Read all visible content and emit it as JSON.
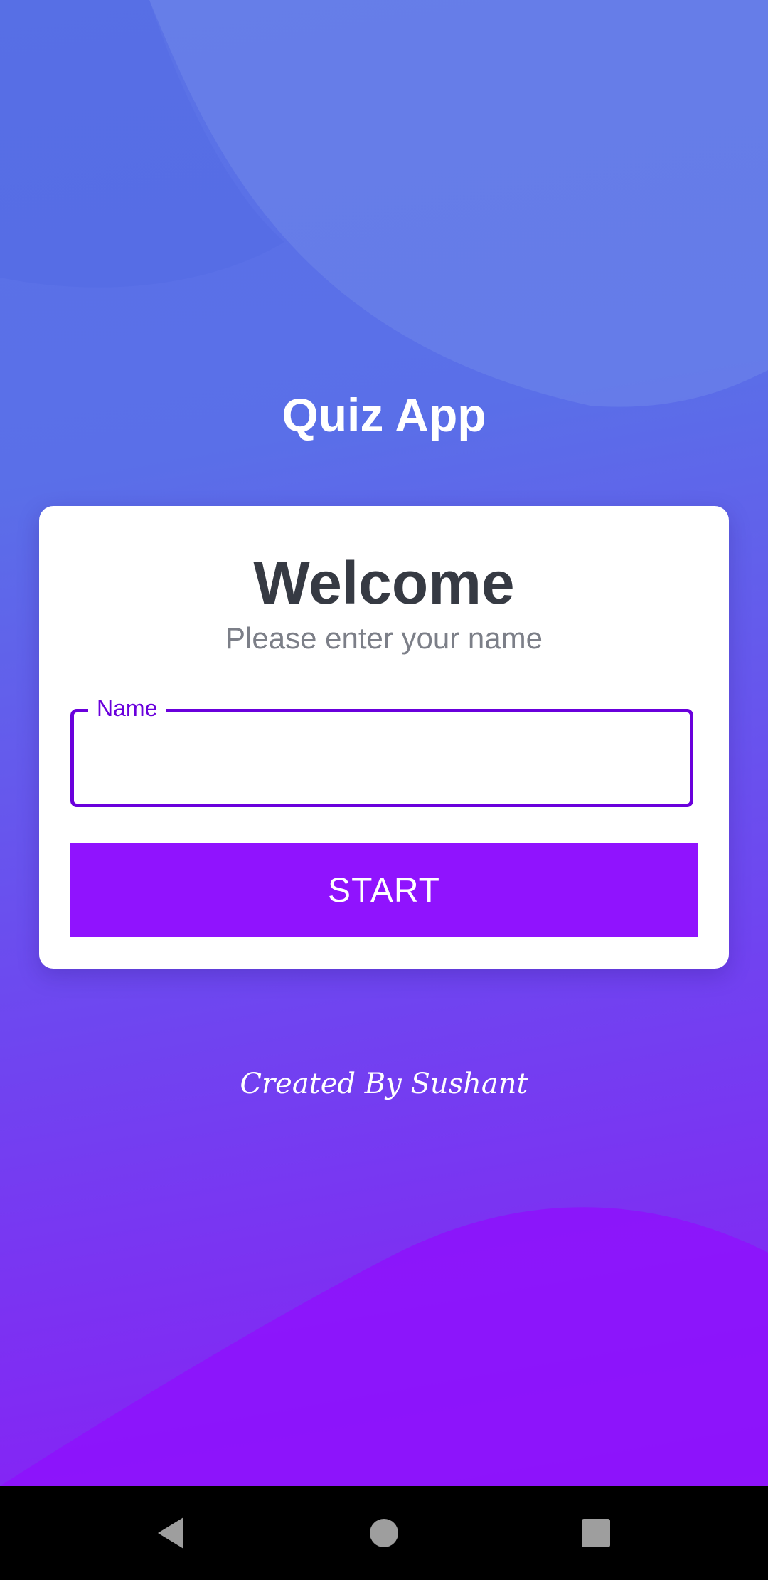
{
  "app": {
    "title": "Quiz App",
    "credit": "Created By Sushant"
  },
  "card": {
    "heading": "Welcome",
    "subtitle": "Please enter your name",
    "name_field": {
      "label": "Name",
      "value": "",
      "placeholder": ""
    },
    "start_button": "START"
  },
  "navbar": {
    "items": [
      "back-icon",
      "home-icon",
      "recents-icon"
    ]
  },
  "colors": {
    "accent": "#9013fe",
    "field_border": "#6a00dc",
    "background_top": "#5b73e6",
    "background_bottom": "#8a1cf5"
  }
}
